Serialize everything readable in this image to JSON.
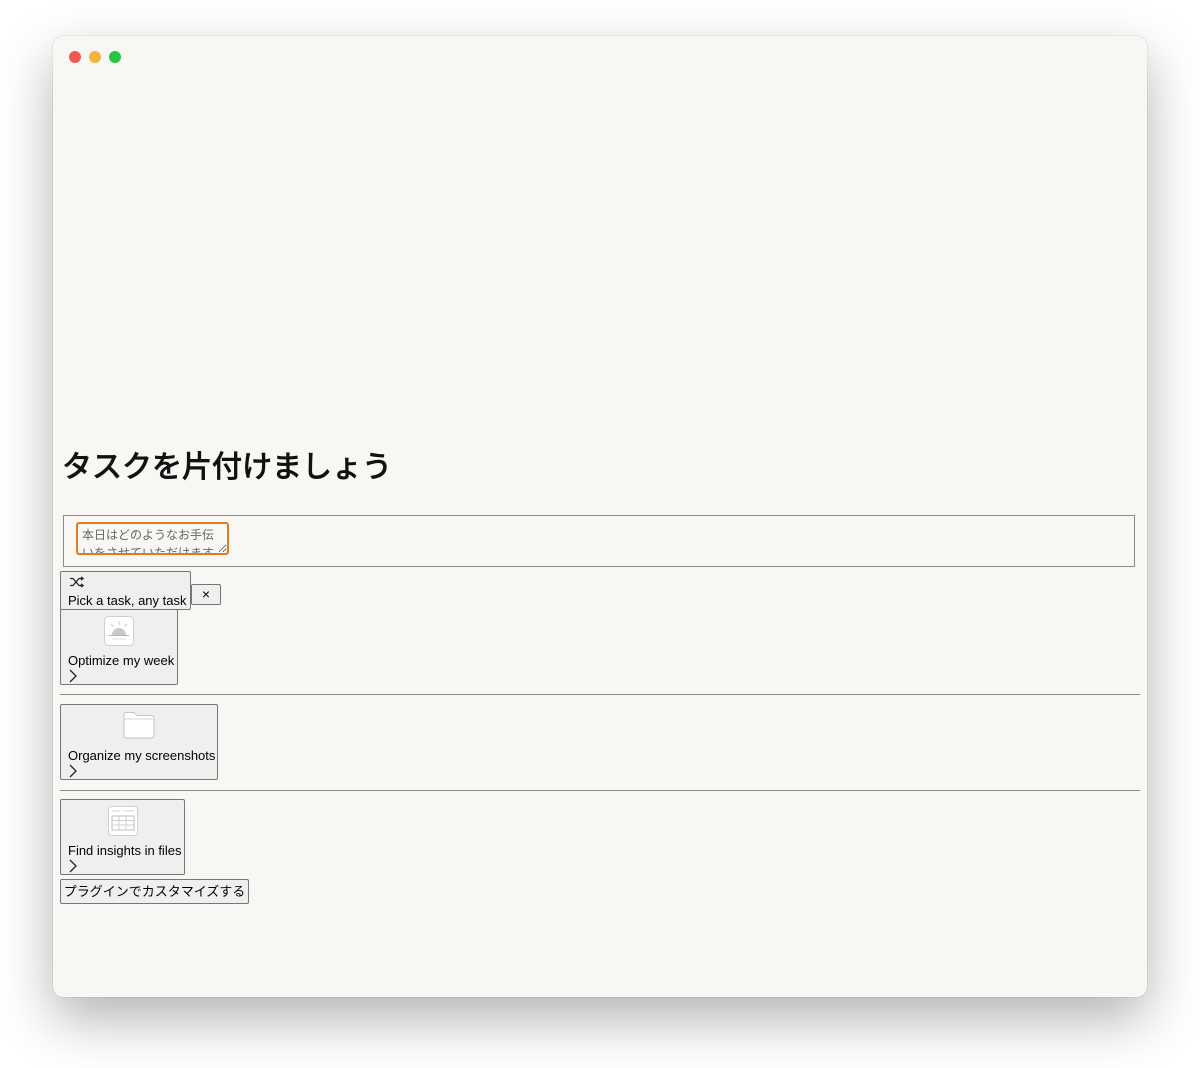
{
  "heading": {
    "title": "タスクを片付けましょう"
  },
  "composer": {
    "placeholder": "本日はどのようなお手伝いをさせていただけますか？"
  },
  "suggestions": {
    "pick_label": "Pick a task, any task",
    "close_label": "×",
    "cards": [
      {
        "label": "Optimize my week",
        "icon": "sunrise-icon"
      },
      {
        "label": "Organize my screenshots",
        "icon": "folder-icon"
      },
      {
        "label": "Find insights in files",
        "icon": "spreadsheet-icon"
      }
    ]
  },
  "plugins": {
    "label": "プラグインでカスタマイズする"
  },
  "colors": {
    "background": "#f8f7f4",
    "focus_ring": "#e07b22",
    "traffic_close": "#ee5a52",
    "traffic_minimize": "#f5b23e",
    "traffic_maximize": "#27c63f"
  }
}
